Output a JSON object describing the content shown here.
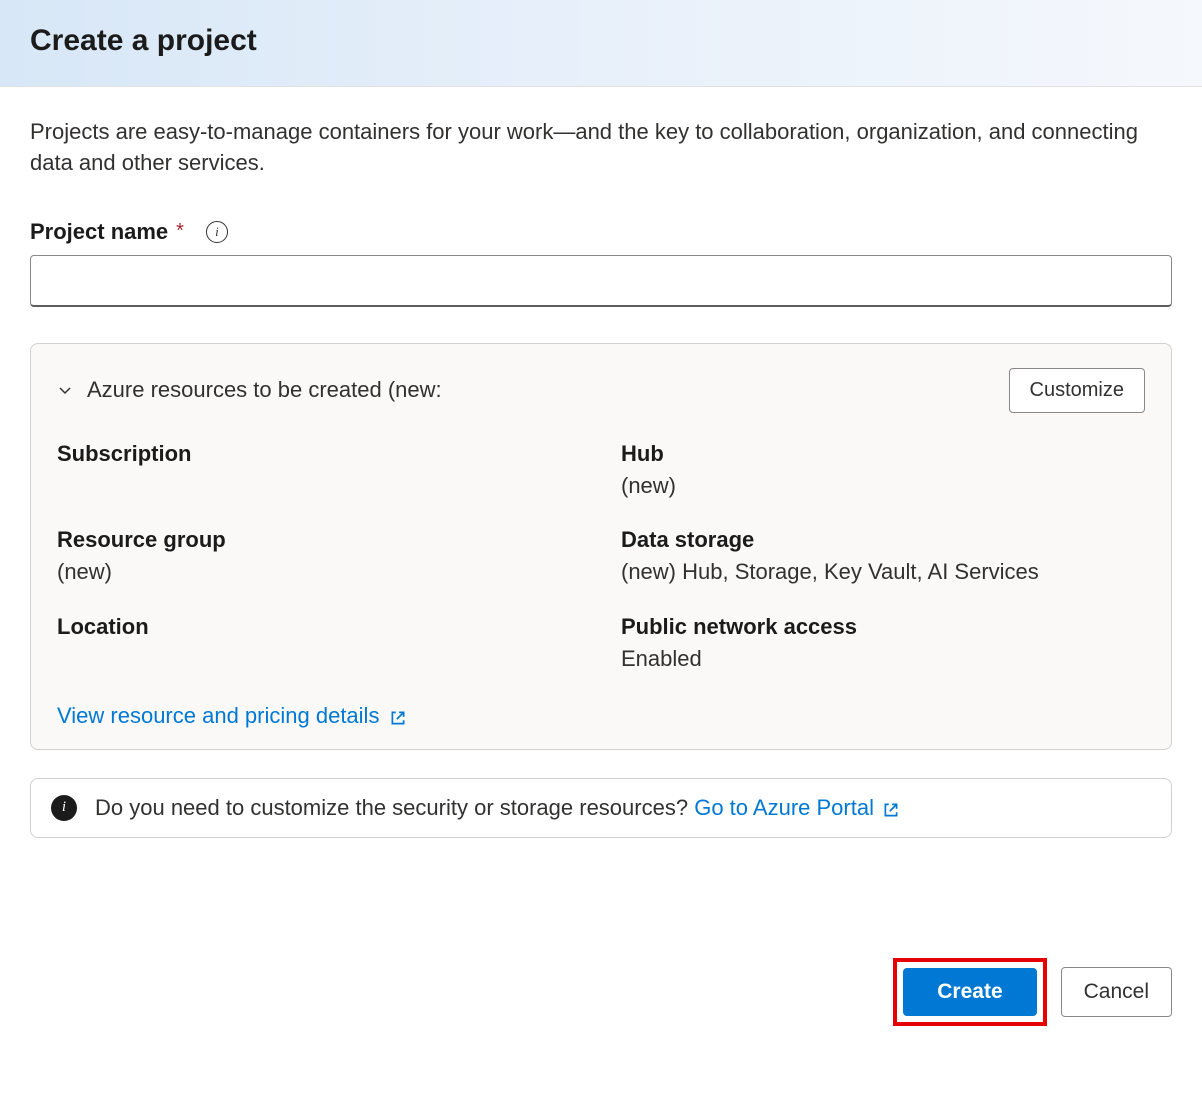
{
  "header": {
    "title": "Create a project"
  },
  "intro": "Projects are easy-to-manage containers for your work—and the key to collaboration, organization, and connecting data and other services.",
  "field": {
    "label": "Project name",
    "value": ""
  },
  "resources": {
    "title": "Azure resources to be created (new:",
    "customize_label": "Customize",
    "items": {
      "subscription": {
        "label": "Subscription",
        "value": ""
      },
      "hub": {
        "label": "Hub",
        "value": "(new)"
      },
      "resource_group": {
        "label": "Resource group",
        "value": "(new)"
      },
      "data_storage": {
        "label": "Data storage",
        "value": "(new) Hub, Storage, Key Vault, AI Services"
      },
      "location": {
        "label": "Location",
        "value": ""
      },
      "network": {
        "label": "Public network access",
        "value": "Enabled"
      }
    },
    "pricing_link": "View resource and pricing details"
  },
  "banner": {
    "text": "Do you need to customize the security or storage resources? ",
    "link": "Go to Azure Portal"
  },
  "buttons": {
    "create": "Create",
    "cancel": "Cancel"
  }
}
